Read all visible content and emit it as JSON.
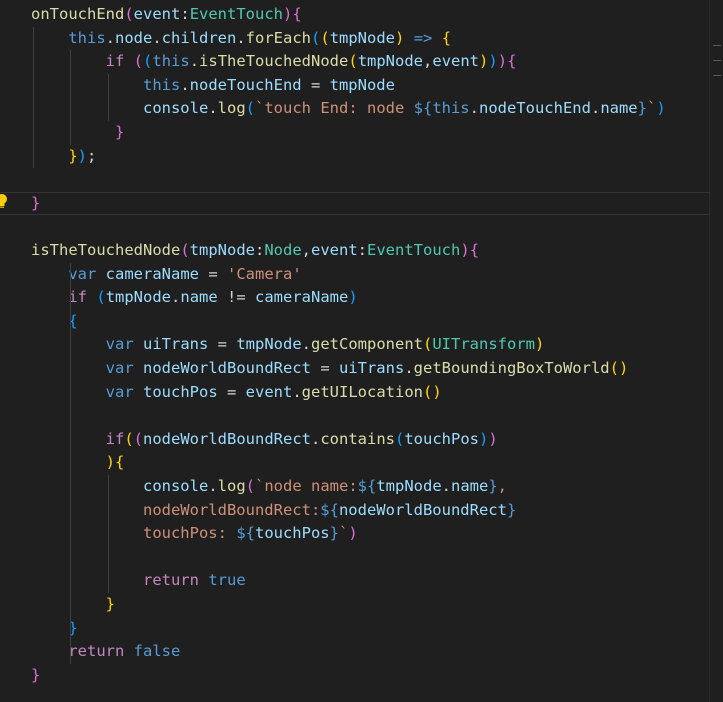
{
  "colors": {
    "background": "#1f1f1f",
    "default": "#d4d4d4",
    "function": "#dcdcaa",
    "variable": "#9cdcfe",
    "keyword": "#569cd6",
    "control": "#c586c0",
    "type": "#4ec9b0",
    "string": "#ce9178",
    "bracket1": "#ffd700",
    "bracket2": "#da70d6",
    "bracket3": "#179fff"
  },
  "icons": {
    "lightbulb": "lightbulb-icon"
  },
  "lines": [
    {
      "tokens": [
        {
          "t": "onTouchEnd",
          "c": "function"
        },
        {
          "t": "(",
          "c": "bracket2"
        },
        {
          "t": "event",
          "c": "variable"
        },
        {
          "t": ":",
          "c": "default"
        },
        {
          "t": "EventTouch",
          "c": "type"
        },
        {
          "t": ")",
          "c": "bracket2"
        },
        {
          "t": "{",
          "c": "bracket2"
        }
      ]
    },
    {
      "tokens": [
        {
          "t": "    ",
          "c": "default"
        },
        {
          "t": "this",
          "c": "keyword"
        },
        {
          "t": ".",
          "c": "default"
        },
        {
          "t": "node",
          "c": "variable"
        },
        {
          "t": ".",
          "c": "default"
        },
        {
          "t": "children",
          "c": "variable"
        },
        {
          "t": ".",
          "c": "default"
        },
        {
          "t": "forEach",
          "c": "function"
        },
        {
          "t": "(",
          "c": "bracket3"
        },
        {
          "t": "(",
          "c": "bracket1"
        },
        {
          "t": "tmpNode",
          "c": "variable"
        },
        {
          "t": ")",
          "c": "bracket1"
        },
        {
          "t": " ",
          "c": "default"
        },
        {
          "t": "=>",
          "c": "keyword"
        },
        {
          "t": " ",
          "c": "default"
        },
        {
          "t": "{",
          "c": "bracket1"
        }
      ]
    },
    {
      "tokens": [
        {
          "t": "        ",
          "c": "default"
        },
        {
          "t": "if",
          "c": "control"
        },
        {
          "t": " ",
          "c": "default"
        },
        {
          "t": "(",
          "c": "bracket2"
        },
        {
          "t": "(",
          "c": "bracket3"
        },
        {
          "t": "this",
          "c": "keyword"
        },
        {
          "t": ".",
          "c": "default"
        },
        {
          "t": "isTheTouchedNode",
          "c": "function"
        },
        {
          "t": "(",
          "c": "bracket1"
        },
        {
          "t": "tmpNode",
          "c": "variable"
        },
        {
          "t": ",",
          "c": "default"
        },
        {
          "t": "event",
          "c": "variable"
        },
        {
          "t": ")",
          "c": "bracket1"
        },
        {
          "t": ")",
          "c": "bracket3"
        },
        {
          "t": ")",
          "c": "bracket2"
        },
        {
          "t": "{",
          "c": "bracket2"
        }
      ]
    },
    {
      "tokens": [
        {
          "t": "            ",
          "c": "default"
        },
        {
          "t": "this",
          "c": "keyword"
        },
        {
          "t": ".",
          "c": "default"
        },
        {
          "t": "nodeTouchEnd",
          "c": "variable"
        },
        {
          "t": " = ",
          "c": "default"
        },
        {
          "t": "tmpNode",
          "c": "variable"
        }
      ]
    },
    {
      "tokens": [
        {
          "t": "            ",
          "c": "default"
        },
        {
          "t": "console",
          "c": "variable"
        },
        {
          "t": ".",
          "c": "default"
        },
        {
          "t": "log",
          "c": "function"
        },
        {
          "t": "(",
          "c": "bracket3"
        },
        {
          "t": "`touch End: node ",
          "c": "string"
        },
        {
          "t": "${",
          "c": "keyword"
        },
        {
          "t": "this",
          "c": "keyword"
        },
        {
          "t": ".",
          "c": "default"
        },
        {
          "t": "nodeTouchEnd",
          "c": "variable"
        },
        {
          "t": ".",
          "c": "default"
        },
        {
          "t": "name",
          "c": "variable"
        },
        {
          "t": "}",
          "c": "keyword"
        },
        {
          "t": "`",
          "c": "string"
        },
        {
          "t": ")",
          "c": "bracket3"
        }
      ]
    },
    {
      "tokens": [
        {
          "t": "         ",
          "c": "default"
        },
        {
          "t": "}",
          "c": "bracket2"
        }
      ]
    },
    {
      "tokens": [
        {
          "t": "    ",
          "c": "default"
        },
        {
          "t": "}",
          "c": "bracket1"
        },
        {
          "t": ")",
          "c": "bracket3"
        },
        {
          "t": ";",
          "c": "default"
        }
      ]
    },
    {
      "tokens": []
    },
    {
      "current": true,
      "tokens": [
        {
          "t": "}",
          "c": "bracket2"
        }
      ]
    },
    {
      "tokens": []
    },
    {
      "tokens": [
        {
          "t": "isTheTouchedNode",
          "c": "function"
        },
        {
          "t": "(",
          "c": "bracket2"
        },
        {
          "t": "tmpNode",
          "c": "variable"
        },
        {
          "t": ":",
          "c": "default"
        },
        {
          "t": "Node",
          "c": "type"
        },
        {
          "t": ",",
          "c": "default"
        },
        {
          "t": "event",
          "c": "variable"
        },
        {
          "t": ":",
          "c": "default"
        },
        {
          "t": "EventTouch",
          "c": "type"
        },
        {
          "t": ")",
          "c": "bracket2"
        },
        {
          "t": "{",
          "c": "bracket2"
        }
      ]
    },
    {
      "tokens": [
        {
          "t": "    ",
          "c": "default"
        },
        {
          "t": "var",
          "c": "keyword"
        },
        {
          "t": " ",
          "c": "default"
        },
        {
          "t": "cameraName",
          "c": "variable"
        },
        {
          "t": " = ",
          "c": "default"
        },
        {
          "t": "'Camera'",
          "c": "string"
        }
      ]
    },
    {
      "tokens": [
        {
          "t": "    ",
          "c": "default"
        },
        {
          "t": "if",
          "c": "control"
        },
        {
          "t": " ",
          "c": "default"
        },
        {
          "t": "(",
          "c": "bracket3"
        },
        {
          "t": "tmpNode",
          "c": "variable"
        },
        {
          "t": ".",
          "c": "default"
        },
        {
          "t": "name",
          "c": "variable"
        },
        {
          "t": " != ",
          "c": "default"
        },
        {
          "t": "cameraName",
          "c": "variable"
        },
        {
          "t": ")",
          "c": "bracket3"
        }
      ]
    },
    {
      "tokens": [
        {
          "t": "    ",
          "c": "default"
        },
        {
          "t": "{",
          "c": "bracket3"
        }
      ]
    },
    {
      "tokens": [
        {
          "t": "        ",
          "c": "default"
        },
        {
          "t": "var",
          "c": "keyword"
        },
        {
          "t": " ",
          "c": "default"
        },
        {
          "t": "uiTrans",
          "c": "variable"
        },
        {
          "t": " = ",
          "c": "default"
        },
        {
          "t": "tmpNode",
          "c": "variable"
        },
        {
          "t": ".",
          "c": "default"
        },
        {
          "t": "getComponent",
          "c": "function"
        },
        {
          "t": "(",
          "c": "bracket1"
        },
        {
          "t": "UITransform",
          "c": "type"
        },
        {
          "t": ")",
          "c": "bracket1"
        }
      ]
    },
    {
      "tokens": [
        {
          "t": "        ",
          "c": "default"
        },
        {
          "t": "var",
          "c": "keyword"
        },
        {
          "t": " ",
          "c": "default"
        },
        {
          "t": "nodeWorldBoundRect",
          "c": "variable"
        },
        {
          "t": " = ",
          "c": "default"
        },
        {
          "t": "uiTrans",
          "c": "variable"
        },
        {
          "t": ".",
          "c": "default"
        },
        {
          "t": "getBoundingBoxToWorld",
          "c": "function"
        },
        {
          "t": "()",
          "c": "bracket1"
        }
      ]
    },
    {
      "tokens": [
        {
          "t": "        ",
          "c": "default"
        },
        {
          "t": "var",
          "c": "keyword"
        },
        {
          "t": " ",
          "c": "default"
        },
        {
          "t": "touchPos",
          "c": "variable"
        },
        {
          "t": " = ",
          "c": "default"
        },
        {
          "t": "event",
          "c": "variable"
        },
        {
          "t": ".",
          "c": "default"
        },
        {
          "t": "getUILocation",
          "c": "function"
        },
        {
          "t": "()",
          "c": "bracket1"
        }
      ]
    },
    {
      "tokens": []
    },
    {
      "tokens": [
        {
          "t": "        ",
          "c": "default"
        },
        {
          "t": "if",
          "c": "control"
        },
        {
          "t": "(",
          "c": "bracket1"
        },
        {
          "t": "(",
          "c": "bracket2"
        },
        {
          "t": "nodeWorldBoundRect",
          "c": "variable"
        },
        {
          "t": ".",
          "c": "default"
        },
        {
          "t": "contains",
          "c": "function"
        },
        {
          "t": "(",
          "c": "bracket3"
        },
        {
          "t": "touchPos",
          "c": "variable"
        },
        {
          "t": ")",
          "c": "bracket3"
        },
        {
          "t": ")",
          "c": "bracket2"
        }
      ]
    },
    {
      "tokens": [
        {
          "t": "        ",
          "c": "default"
        },
        {
          "t": ")",
          "c": "bracket1"
        },
        {
          "t": "{",
          "c": "bracket1"
        }
      ]
    },
    {
      "tokens": [
        {
          "t": "            ",
          "c": "default"
        },
        {
          "t": "console",
          "c": "variable"
        },
        {
          "t": ".",
          "c": "default"
        },
        {
          "t": "log",
          "c": "function"
        },
        {
          "t": "(",
          "c": "bracket2"
        },
        {
          "t": "`node name:",
          "c": "string"
        },
        {
          "t": "${",
          "c": "keyword"
        },
        {
          "t": "tmpNode",
          "c": "variable"
        },
        {
          "t": ".",
          "c": "default"
        },
        {
          "t": "name",
          "c": "variable"
        },
        {
          "t": "}",
          "c": "keyword"
        },
        {
          "t": ",",
          "c": "string"
        }
      ]
    },
    {
      "tokens": [
        {
          "t": "            ",
          "c": "default"
        },
        {
          "t": "nodeWorldBoundRect:",
          "c": "string"
        },
        {
          "t": "${",
          "c": "keyword"
        },
        {
          "t": "nodeWorldBoundRect",
          "c": "variable"
        },
        {
          "t": "}",
          "c": "keyword"
        }
      ]
    },
    {
      "tokens": [
        {
          "t": "            ",
          "c": "default"
        },
        {
          "t": "touchPos: ",
          "c": "string"
        },
        {
          "t": "${",
          "c": "keyword"
        },
        {
          "t": "touchPos",
          "c": "variable"
        },
        {
          "t": "}",
          "c": "keyword"
        },
        {
          "t": "`",
          "c": "string"
        },
        {
          "t": ")",
          "c": "bracket2"
        }
      ]
    },
    {
      "tokens": []
    },
    {
      "tokens": [
        {
          "t": "            ",
          "c": "default"
        },
        {
          "t": "return",
          "c": "control"
        },
        {
          "t": " ",
          "c": "default"
        },
        {
          "t": "true",
          "c": "keyword"
        }
      ]
    },
    {
      "tokens": [
        {
          "t": "        ",
          "c": "default"
        },
        {
          "t": "}",
          "c": "bracket1"
        }
      ]
    },
    {
      "tokens": [
        {
          "t": "    ",
          "c": "default"
        },
        {
          "t": "}",
          "c": "bracket3"
        }
      ]
    },
    {
      "tokens": [
        {
          "t": "    ",
          "c": "default"
        },
        {
          "t": "return",
          "c": "control"
        },
        {
          "t": " ",
          "c": "default"
        },
        {
          "t": "false",
          "c": "keyword"
        }
      ]
    },
    {
      "tokens": [
        {
          "t": "}",
          "c": "bracket2"
        }
      ]
    }
  ]
}
